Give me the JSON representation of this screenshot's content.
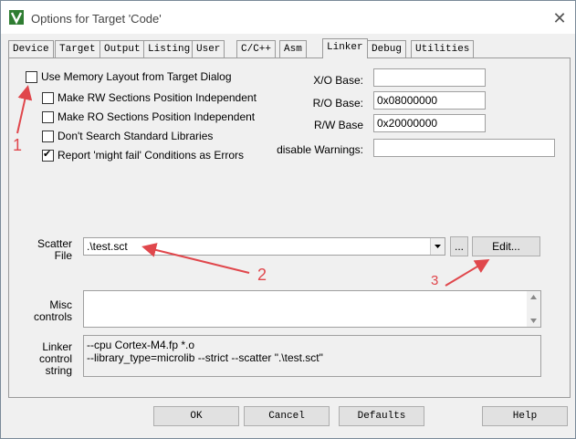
{
  "window": {
    "title": "Options for Target 'Code'"
  },
  "tabs": [
    {
      "label": "Device"
    },
    {
      "label": "Target"
    },
    {
      "label": "Output"
    },
    {
      "label": "Listing"
    },
    {
      "label": "User"
    },
    {
      "label": "C/C++"
    },
    {
      "label": "Asm"
    },
    {
      "label": "Linker"
    },
    {
      "label": "Debug"
    },
    {
      "label": "Utilities"
    }
  ],
  "active_tab": "Linker",
  "options": {
    "use_memory_layout": {
      "label": "Use Memory Layout from Target Dialog",
      "checked": false
    },
    "rw_independent": {
      "label": "Make RW Sections Position Independent",
      "checked": false
    },
    "ro_independent": {
      "label": "Make RO Sections Position Independent",
      "checked": false
    },
    "no_std_libs": {
      "label": "Don't Search Standard Libraries",
      "checked": false
    },
    "might_fail": {
      "label": "Report 'might fail' Conditions as Errors",
      "checked": true
    }
  },
  "bases": {
    "xo_label": "X/O Base:",
    "xo_value": "",
    "ro_label": "R/O Base:",
    "ro_value": "0x08000000",
    "rw_label": "R/W Base",
    "rw_value": "0x20000000",
    "warn_label": "disable Warnings:",
    "warn_value": ""
  },
  "scatter": {
    "label_line1": "Scatter",
    "label_line2": "File",
    "value": ".\\test.sct",
    "browse_label": "...",
    "edit_label": "Edit..."
  },
  "misc": {
    "label_line1": "Misc",
    "label_line2": "controls",
    "value": ""
  },
  "control_string": {
    "label_line1": "Linker",
    "label_line2": "control",
    "label_line3": "string",
    "line1": "--cpu Cortex-M4.fp *.o",
    "line2": "--library_type=microlib --strict --scatter \".\\test.sct\""
  },
  "buttons": {
    "ok": "OK",
    "cancel": "Cancel",
    "defaults": "Defaults",
    "help": "Help"
  },
  "annotations": {
    "a1": "1",
    "a2": "2",
    "a3": "3",
    "color": "#e0474c"
  },
  "colors": {
    "app_icon": "#3a8a3a"
  }
}
